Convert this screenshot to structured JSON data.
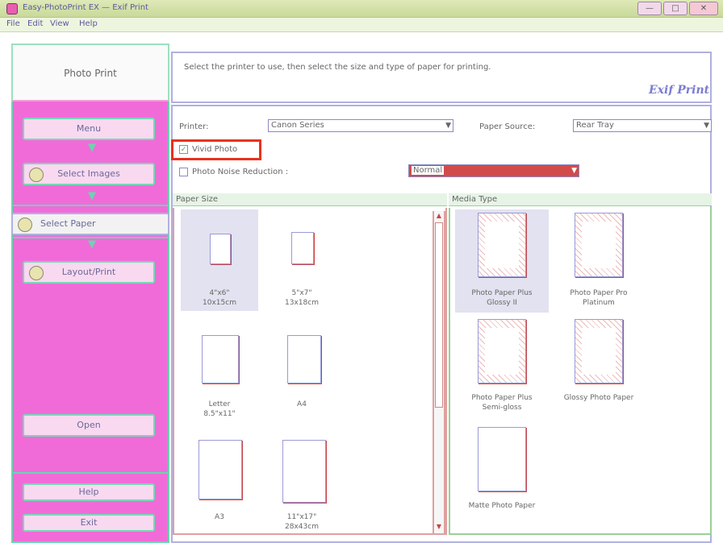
{
  "window": {
    "title": "Easy-PhotoPrint EX — Exif Print",
    "minimize_icon": "minimize-icon",
    "maximize_icon": "maximize-icon",
    "close_icon": "close-icon"
  },
  "menu": [
    "File",
    "Edit",
    "View",
    "Help"
  ],
  "sidebar": {
    "header": "Photo Print",
    "steps": [
      {
        "label": "Menu",
        "icon": "home-icon"
      },
      {
        "label": "Select Images",
        "icon": "select-images-icon"
      },
      {
        "label": "Select Paper",
        "icon": "select-paper-icon",
        "active": true
      },
      {
        "label": "Layout/Print",
        "icon": "layout-print-icon"
      }
    ],
    "open_label": "Open",
    "help_label": "Help",
    "exit_label": "Exit"
  },
  "instructions": {
    "text": "Select the printer to use, then select the size and type of paper for printing.",
    "logo": "Exif Print"
  },
  "settings": {
    "printer_label": "Printer:",
    "printer_value": "Canon          Series",
    "paper_source_label": "Paper Source:",
    "paper_source_value": "Rear Tray",
    "vivid_photo_label": "Vivid Photo",
    "vivid_photo_checked": true,
    "noise_reduction_label": "Photo Noise Reduction :",
    "noise_reduction_checked": false,
    "noise_reduction_value": "Normal",
    "highlight_color": "#e8321e"
  },
  "paper_size": {
    "header": "Paper Size",
    "items": [
      {
        "line1": "4\"x6\"",
        "line2": "10x15cm",
        "selected": true
      },
      {
        "line1": "5\"x7\"",
        "line2": "13x18cm",
        "selected": false
      },
      {
        "line1": "Letter",
        "line2": "8.5\"x11\"",
        "selected": false
      },
      {
        "line1": "A4",
        "line2": "",
        "selected": false
      },
      {
        "line1": "A3",
        "line2": "",
        "selected": false
      },
      {
        "line1": "11\"x17\"",
        "line2": "28x43cm",
        "selected": false
      }
    ]
  },
  "media_type": {
    "header": "Media Type",
    "items": [
      {
        "line1": "Photo Paper Plus",
        "line2": "Glossy II",
        "selected": true
      },
      {
        "line1": "Photo Paper Pro",
        "line2": "Platinum",
        "selected": false
      },
      {
        "line1": "Photo Paper Plus",
        "line2": "Semi-gloss",
        "selected": false
      },
      {
        "line1": "Glossy Photo Paper",
        "line2": "",
        "selected": false
      },
      {
        "line1": "Matte Photo Paper",
        "line2": "",
        "selected": false
      }
    ]
  }
}
